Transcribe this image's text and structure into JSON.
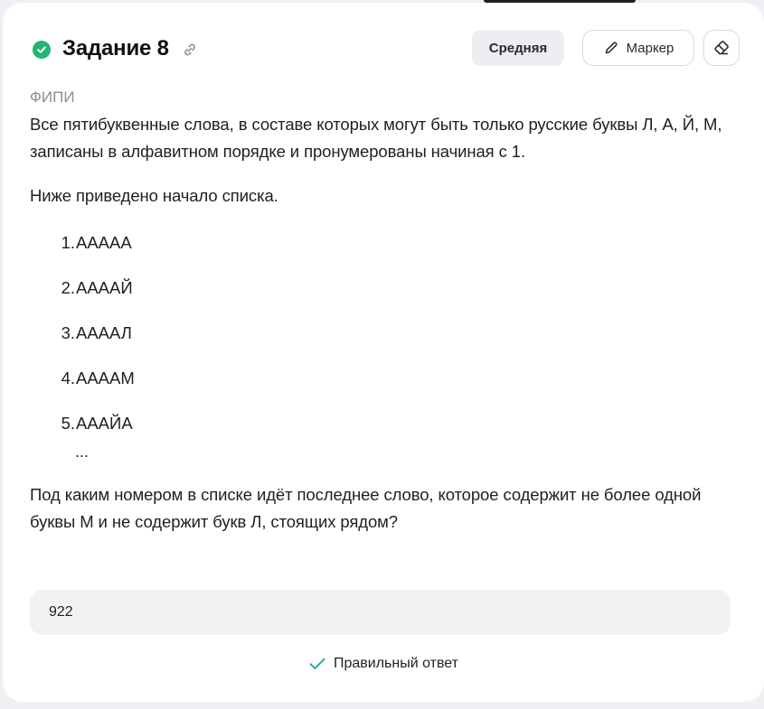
{
  "task": {
    "title": "Задание 8",
    "difficulty": "Средняя",
    "marker_label": "Маркер",
    "source": "ФИПИ",
    "paragraph1": "Все пятибуквенные слова, в составе которых могут быть только русские буквы Л, А, Й, М, записаны в алфавитном порядке и пронумерованы начиная с 1.",
    "paragraph2": "Ниже приведено начало списка.",
    "list": [
      {
        "num": "1.",
        "word": "ААААА"
      },
      {
        "num": "2.",
        "word": "ААААЙ"
      },
      {
        "num": "3.",
        "word": "ААААЛ"
      },
      {
        "num": "4.",
        "word": "ААААМ"
      },
      {
        "num": "5.",
        "word": "АААЙА"
      }
    ],
    "ellipsis": "...",
    "question": "Под каким номером в списке идёт последнее слово, которое содержит не более одной буквы М и не содержит букв Л, стоящих рядом?"
  },
  "answer": {
    "value": "922",
    "result_label": "Правильный ответ"
  },
  "colors": {
    "success": "#22b573",
    "check_mark": "#1aa89a",
    "badge_bg": "#eceef2"
  },
  "icons": {
    "status": "check-circle-icon",
    "link": "link-icon",
    "marker": "pencil-icon",
    "eraser": "eraser-icon",
    "result": "checkmark-icon"
  }
}
